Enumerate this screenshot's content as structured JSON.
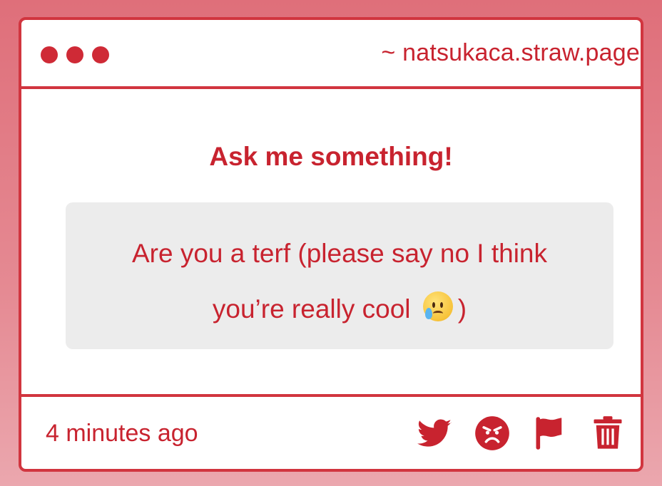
{
  "window": {
    "url": "~ natsukaca.straw.page"
  },
  "content": {
    "heading": "Ask me something!",
    "question_line1": "Are you a terf (please say no I think",
    "question_line2_before": "you’re really cool",
    "question_emoji": "face-holding-back-tears",
    "question_line2_after": ")"
  },
  "footer": {
    "timestamp": "4 minutes ago",
    "actions": [
      "twitter-icon",
      "angry-face-icon",
      "flag-icon",
      "trash-icon"
    ]
  },
  "colors": {
    "accent": "#c8232f",
    "border": "#d1353f",
    "question_bg": "#ececec"
  }
}
